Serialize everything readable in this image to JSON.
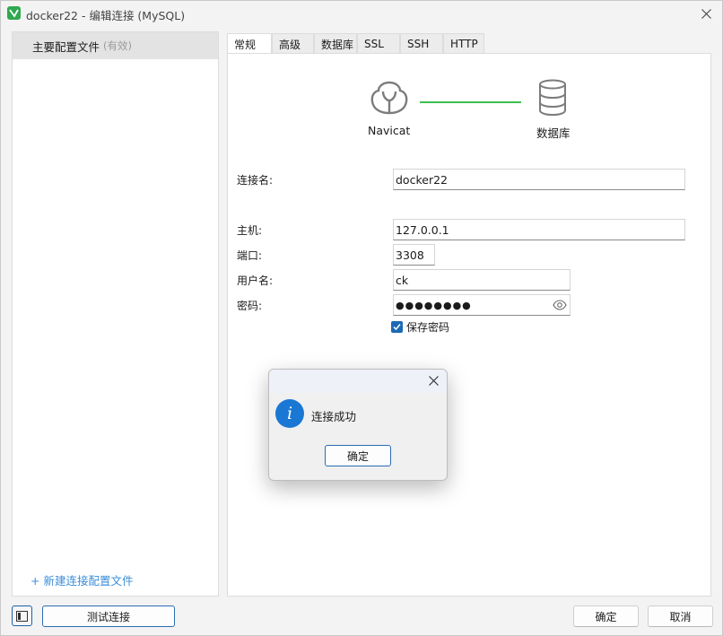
{
  "window": {
    "title": "docker22 - 编辑连接 (MySQL)"
  },
  "left_panel": {
    "profile_name": "主要配置文件",
    "profile_status": "(有效)",
    "new_profile_link": "+ 新建连接配置文件"
  },
  "tabs": [
    "常规",
    "高级",
    "数据库",
    "SSL",
    "SSH",
    "HTTP"
  ],
  "diagram": {
    "left_label": "Navicat",
    "right_label": "数据库"
  },
  "form": {
    "conn_name_label": "连接名:",
    "conn_name_value": "docker22",
    "host_label": "主机:",
    "host_value": "127.0.0.1",
    "port_label": "端口:",
    "port_value": "3308",
    "user_label": "用户名:",
    "user_value": "ck",
    "password_label": "密码:",
    "password_mask": "●●●●●●●●",
    "save_password_label": "保存密码",
    "save_password_checked": true
  },
  "footer": {
    "test_button": "测试连接",
    "ok_button": "确定",
    "cancel_button": "取消"
  },
  "dialog": {
    "message": "连接成功",
    "ok_button": "确定"
  },
  "colors": {
    "accent": "#1b69b6",
    "link": "#3a8ed8",
    "connector": "#3cc04f",
    "app_icon": "#2fa84f"
  }
}
